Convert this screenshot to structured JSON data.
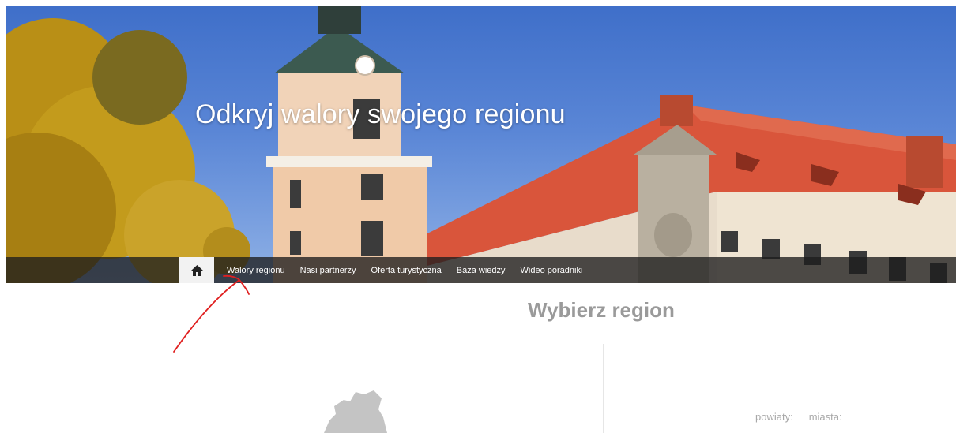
{
  "hero": {
    "title": "Odkryj walory swojego regionu"
  },
  "nav": {
    "home_icon": "home-icon",
    "items": [
      {
        "label": "Walory regionu"
      },
      {
        "label": "Nasi partnerzy"
      },
      {
        "label": "Oferta turystyczna"
      },
      {
        "label": "Baza wiedzy"
      },
      {
        "label": "Wideo poradniki"
      }
    ]
  },
  "main": {
    "heading": "Wybierz region"
  },
  "stats": {
    "counties_label": "powiaty:",
    "cities_label": "miasta:"
  },
  "colors": {
    "nav_bar": "#1e1e1e",
    "annotation": "#e02020",
    "heading": "#9a9a9a",
    "roof": "#d9543a",
    "sky": "#4a78cf"
  }
}
